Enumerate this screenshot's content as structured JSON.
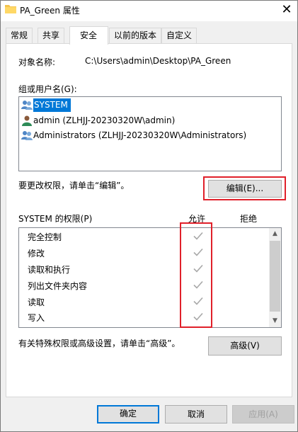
{
  "window": {
    "title": "PA_Green 属性",
    "close_glyph": "✕"
  },
  "tabs": [
    {
      "label": "常规",
      "active": false
    },
    {
      "label": "共享",
      "active": false
    },
    {
      "label": "安全",
      "active": true
    },
    {
      "label": "以前的版本",
      "active": false
    },
    {
      "label": "自定义",
      "active": false
    }
  ],
  "security": {
    "object_name_label": "对象名称:",
    "object_name_value": "C:\\Users\\admin\\Desktop\\PA_Green",
    "groups_label": "组或用户名(G):",
    "users": [
      {
        "name": "SYSTEM",
        "selected": true,
        "icon": "group-users-icon"
      },
      {
        "name": "admin (ZLHJJ-20230320W\\admin)",
        "selected": false,
        "icon": "user-icon"
      },
      {
        "name": "Administrators (ZLHJJ-20230320W\\Administrators)",
        "selected": false,
        "icon": "group-users-icon"
      }
    ],
    "edit_hint": "要更改权限，请单击“编辑”。",
    "edit_button": "编辑(E)...",
    "permissions_label": "SYSTEM 的权限(P)",
    "allow_header": "允许",
    "deny_header": "拒绝",
    "permissions": [
      {
        "name": "完全控制",
        "allow": true,
        "deny": false
      },
      {
        "name": "修改",
        "allow": true,
        "deny": false
      },
      {
        "name": "读取和执行",
        "allow": true,
        "deny": false
      },
      {
        "name": "列出文件夹内容",
        "allow": true,
        "deny": false
      },
      {
        "name": "读取",
        "allow": true,
        "deny": false
      },
      {
        "name": "写入",
        "allow": true,
        "deny": false
      }
    ],
    "advanced_hint": "有关特殊权限或高级设置，请单击“高级”。",
    "advanced_button": "高级(V)"
  },
  "footer": {
    "ok": "确定",
    "cancel": "取消",
    "apply": "应用(A)"
  },
  "colors": {
    "selection": "#0078d7",
    "highlight_box": "#e0202a",
    "check_gray": "#a8a8a8"
  }
}
